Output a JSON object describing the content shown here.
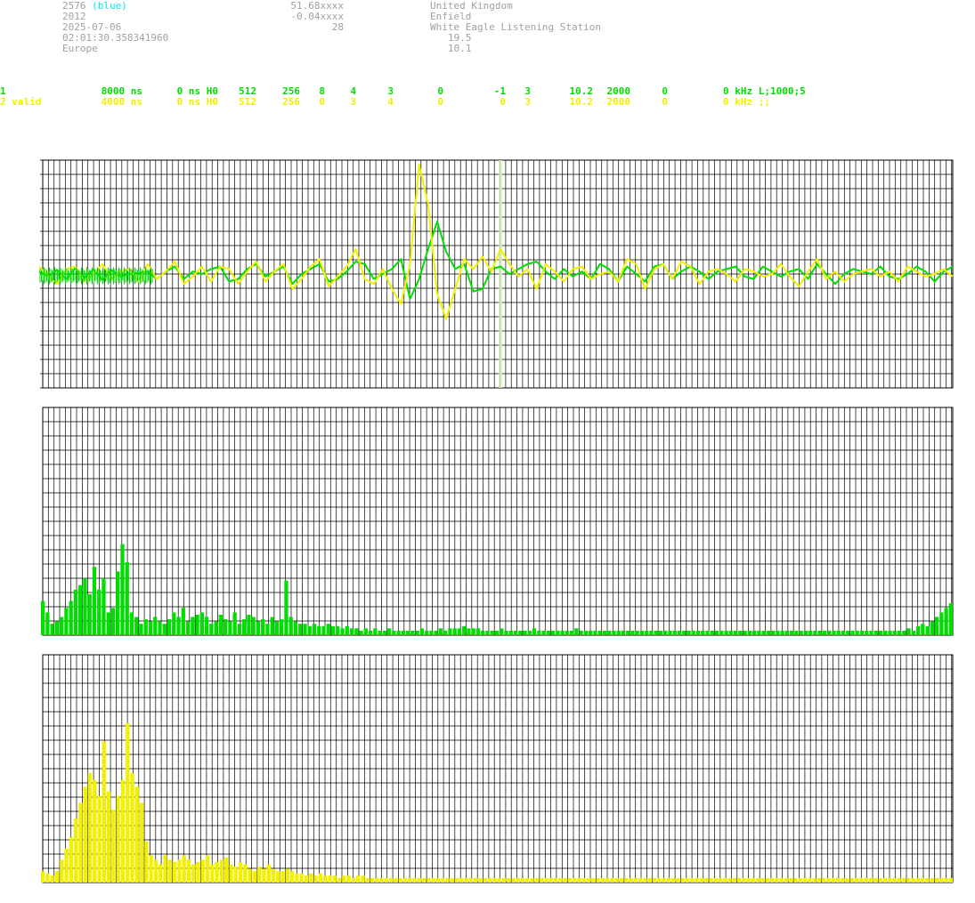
{
  "info": {
    "col1": [
      "2576",
      "2012",
      "2025-07-06",
      "02:01:30.358341960",
      "Europe"
    ],
    "col1_suffix": "(blue)",
    "col2": [
      "51.68xxxx",
      "-0.04xxxx",
      "28"
    ],
    "col3": [
      "United Kingdom",
      "Enfield",
      "White Eagle Listening Station"
    ],
    "col3_values": [
      "19.5",
      "10.1"
    ]
  },
  "channels": [
    {
      "color": "#00dd00",
      "cells": [
        "1",
        "8000 ns",
        "0 ns H0",
        "512",
        "256",
        "8",
        "4",
        "3",
        "0",
        "-1",
        "3",
        "10.2",
        "2000",
        "0",
        "0 kHz L;1000;5"
      ]
    },
    {
      "color": "#f0f000",
      "cells": [
        "2 valid",
        "4000 ns",
        "0 ns H0",
        "512",
        "256",
        "0",
        "3",
        "4",
        "0",
        "0",
        "3",
        "10.2",
        "2000",
        "0",
        "0 kHz ;;"
      ]
    }
  ],
  "chart_data": [
    {
      "type": "line",
      "series": [
        {
          "color": "#00dd00",
          "values": [
            0.05,
            -0.05,
            0.08,
            -0.1,
            0.12,
            -0.08,
            0.1,
            -0.12,
            0.08,
            -0.05,
            0.0,
            0.02,
            0.05,
            -0.1,
            0.05,
            0.15,
            -0.1,
            0.05,
            0.0,
            0.1,
            0.15,
            -0.15,
            -0.1,
            0.1,
            0.2,
            -0.05,
            0.05,
            0.15,
            -0.2,
            0.0,
            0.1,
            0.2,
            -0.15,
            -0.1,
            0.05,
            0.25,
            0.2,
            -0.1,
            0.0,
            0.1,
            0.3,
            -0.5,
            -0.1,
            0.5,
            1.05,
            0.45,
            0.1,
            0.2,
            -0.35,
            -0.3,
            0.1,
            0.15,
            0.0,
            0.1,
            0.2,
            0.25,
            0.05,
            -0.1,
            0.1,
            -0.05,
            0.05,
            -0.1,
            0.2,
            0.1,
            -0.15,
            0.15,
            0.0,
            -0.15,
            0.15,
            0.2,
            -0.1,
            0.05,
            0.15,
            0.05,
            -0.1,
            0.05,
            0.1,
            0.15,
            -0.05,
            -0.1,
            0.15,
            0.05,
            -0.05,
            0.05,
            0.1,
            -0.1,
            0.2,
            0.0,
            -0.2,
            0.0,
            0.1,
            0.05,
            0.0,
            0.15,
            -0.05,
            -0.1,
            0.0,
            0.15,
            0.05,
            -0.15,
            0.05,
            0.15
          ]
        },
        {
          "color": "#f0f000",
          "values": [
            0.15,
            -0.05,
            -0.2,
            0.1,
            0.15,
            -0.15,
            0.0,
            0.2,
            -0.1,
            0.05,
            0.1,
            -0.15,
            0.2,
            -0.1,
            0.05,
            0.25,
            -0.2,
            -0.05,
            0.15,
            -0.15,
            0.15,
            0.1,
            -0.2,
            0.05,
            0.25,
            -0.15,
            0.05,
            0.2,
            -0.3,
            -0.1,
            0.15,
            0.3,
            -0.25,
            -0.05,
            0.15,
            0.5,
            -0.1,
            -0.2,
            0.1,
            -0.3,
            -0.6,
            0.2,
            2.2,
            1.4,
            -0.4,
            -0.9,
            -0.3,
            0.3,
            0.1,
            0.35,
            0.05,
            0.5,
            0.2,
            -0.05,
            0.1,
            -0.3,
            0.2,
            0.05,
            -0.15,
            0.1,
            0.15,
            -0.1,
            0.0,
            0.05,
            -0.15,
            0.3,
            0.2,
            -0.3,
            0.1,
            0.2,
            -0.1,
            0.25,
            0.15,
            -0.2,
            0.05,
            0.1,
            0.0,
            -0.15,
            0.1,
            0.05,
            -0.05,
            0.0,
            0.2,
            -0.05,
            -0.25,
            0.05,
            0.3,
            -0.1,
            0.05,
            -0.15,
            0.0,
            0.05,
            0.1,
            -0.05,
            0.05,
            -0.15,
            0.15,
            0.05,
            -0.05,
            0.0,
            0.1,
            -0.05
          ]
        }
      ],
      "marker_fraction": 0.503
    },
    {
      "type": "bar",
      "color": "#00dd00",
      "values": [
        0.15,
        0.1,
        0.05,
        0.06,
        0.08,
        0.12,
        0.15,
        0.2,
        0.22,
        0.25,
        0.18,
        0.3,
        0.2,
        0.25,
        0.1,
        0.12,
        0.28,
        0.4,
        0.32,
        0.1,
        0.08,
        0.05,
        0.07,
        0.06,
        0.08,
        0.06,
        0.05,
        0.07,
        0.1,
        0.08,
        0.12,
        0.06,
        0.08,
        0.09,
        0.1,
        0.08,
        0.05,
        0.06,
        0.09,
        0.07,
        0.06,
        0.1,
        0.05,
        0.07,
        0.09,
        0.08,
        0.06,
        0.07,
        0.05,
        0.08,
        0.06,
        0.07,
        0.24,
        0.08,
        0.06,
        0.05,
        0.05,
        0.04,
        0.05,
        0.04,
        0.04,
        0.05,
        0.04,
        0.04,
        0.03,
        0.04,
        0.03,
        0.03,
        0.02,
        0.03,
        0.02,
        0.03,
        0.02,
        0.02,
        0.03,
        0.02,
        0.02,
        0.02,
        0.02,
        0.02,
        0.02,
        0.03,
        0.02,
        0.02,
        0.02,
        0.03,
        0.02,
        0.03,
        0.03,
        0.03,
        0.04,
        0.03,
        0.03,
        0.03,
        0.02,
        0.02,
        0.02,
        0.02,
        0.03,
        0.02,
        0.02,
        0.02,
        0.02,
        0.02,
        0.02,
        0.03,
        0.02,
        0.02,
        0.02,
        0.02,
        0.02,
        0.02,
        0.02,
        0.02,
        0.03,
        0.02,
        0.02,
        0.02,
        0.02,
        0.02,
        0.02,
        0.02,
        0.02,
        0.02,
        0.02,
        0.02,
        0.02,
        0.02,
        0.02,
        0.02,
        0.02,
        0.02,
        0.02,
        0.02,
        0.02,
        0.02,
        0.02,
        0.02,
        0.02,
        0.02,
        0.02,
        0.02,
        0.02,
        0.02,
        0.02,
        0.02,
        0.02,
        0.02,
        0.02,
        0.02,
        0.02,
        0.02,
        0.02,
        0.02,
        0.02,
        0.02,
        0.02,
        0.02,
        0.02,
        0.02,
        0.02,
        0.02,
        0.02,
        0.02,
        0.02,
        0.02,
        0.02,
        0.02,
        0.02,
        0.02,
        0.02,
        0.02,
        0.02,
        0.02,
        0.02,
        0.02,
        0.02,
        0.02,
        0.02,
        0.02,
        0.02,
        0.02,
        0.02,
        0.02,
        0.02,
        0.03,
        0.02,
        0.04,
        0.05,
        0.04,
        0.06,
        0.08,
        0.1,
        0.12,
        0.14
      ]
    },
    {
      "type": "bar",
      "color": "#f0f000",
      "values": [
        0.05,
        0.04,
        0.03,
        0.05,
        0.1,
        0.15,
        0.2,
        0.28,
        0.35,
        0.42,
        0.48,
        0.45,
        0.38,
        0.62,
        0.4,
        0.32,
        0.38,
        0.45,
        0.7,
        0.48,
        0.42,
        0.35,
        0.18,
        0.12,
        0.1,
        0.08,
        0.12,
        0.1,
        0.09,
        0.1,
        0.12,
        0.1,
        0.08,
        0.09,
        0.1,
        0.12,
        0.08,
        0.09,
        0.1,
        0.11,
        0.08,
        0.07,
        0.09,
        0.08,
        0.06,
        0.05,
        0.07,
        0.06,
        0.08,
        0.06,
        0.05,
        0.05,
        0.06,
        0.05,
        0.04,
        0.04,
        0.03,
        0.04,
        0.03,
        0.04,
        0.03,
        0.03,
        0.03,
        0.02,
        0.03,
        0.03,
        0.02,
        0.03,
        0.03,
        0.02,
        0.02,
        0.02,
        0.02,
        0.02,
        0.02,
        0.02,
        0.02,
        0.02,
        0.02,
        0.02,
        0.02,
        0.02,
        0.02,
        0.02,
        0.02,
        0.02,
        0.02,
        0.02,
        0.02,
        0.02,
        0.02,
        0.02,
        0.02,
        0.02,
        0.02,
        0.02,
        0.02,
        0.02,
        0.02,
        0.02,
        0.02,
        0.02,
        0.02,
        0.02,
        0.02,
        0.02,
        0.02,
        0.02,
        0.02,
        0.02,
        0.02,
        0.02,
        0.02,
        0.02,
        0.02,
        0.02,
        0.02,
        0.02,
        0.02,
        0.02,
        0.02,
        0.02,
        0.02,
        0.02,
        0.02,
        0.02,
        0.02,
        0.02,
        0.02,
        0.02,
        0.02,
        0.02,
        0.02,
        0.02,
        0.02,
        0.02,
        0.02,
        0.02,
        0.02,
        0.02,
        0.02,
        0.02,
        0.02,
        0.02,
        0.02,
        0.02,
        0.02,
        0.02,
        0.02,
        0.02,
        0.02,
        0.02,
        0.02,
        0.02,
        0.02,
        0.02,
        0.02,
        0.02,
        0.02,
        0.02,
        0.02,
        0.02,
        0.02,
        0.02,
        0.02,
        0.02,
        0.02,
        0.02,
        0.02,
        0.02,
        0.02,
        0.02,
        0.02,
        0.02,
        0.02,
        0.02,
        0.02,
        0.02,
        0.02,
        0.02,
        0.02,
        0.02,
        0.02,
        0.02,
        0.02,
        0.02,
        0.02,
        0.02,
        0.02,
        0.02,
        0.02,
        0.02,
        0.02,
        0.02
      ]
    }
  ]
}
